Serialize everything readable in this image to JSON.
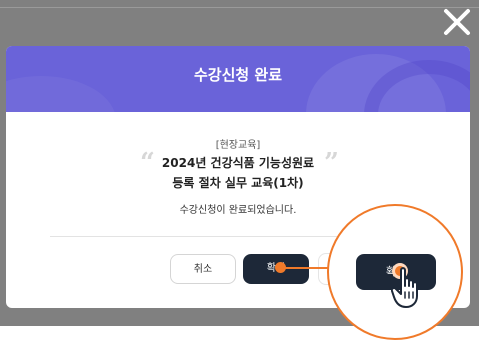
{
  "modal": {
    "title": "수강신청 완료",
    "edu_type": "[현장교육]",
    "course_line1": "2024년 건강식품 기능성원료",
    "course_line2": "등록 절차 실무 교육(1차)",
    "message": "수강신청이 완료되었습니다.",
    "cancel_label": "취소",
    "confirm_label": "확인",
    "quote_open": "“",
    "quote_close": "”"
  },
  "icons": {
    "close": "close-icon",
    "hand": "hand-pointer-icon"
  },
  "colors": {
    "header": "#6a63d9",
    "confirm_button": "#1d2838",
    "highlight": "#f07a2a",
    "backdrop": "#808080"
  }
}
